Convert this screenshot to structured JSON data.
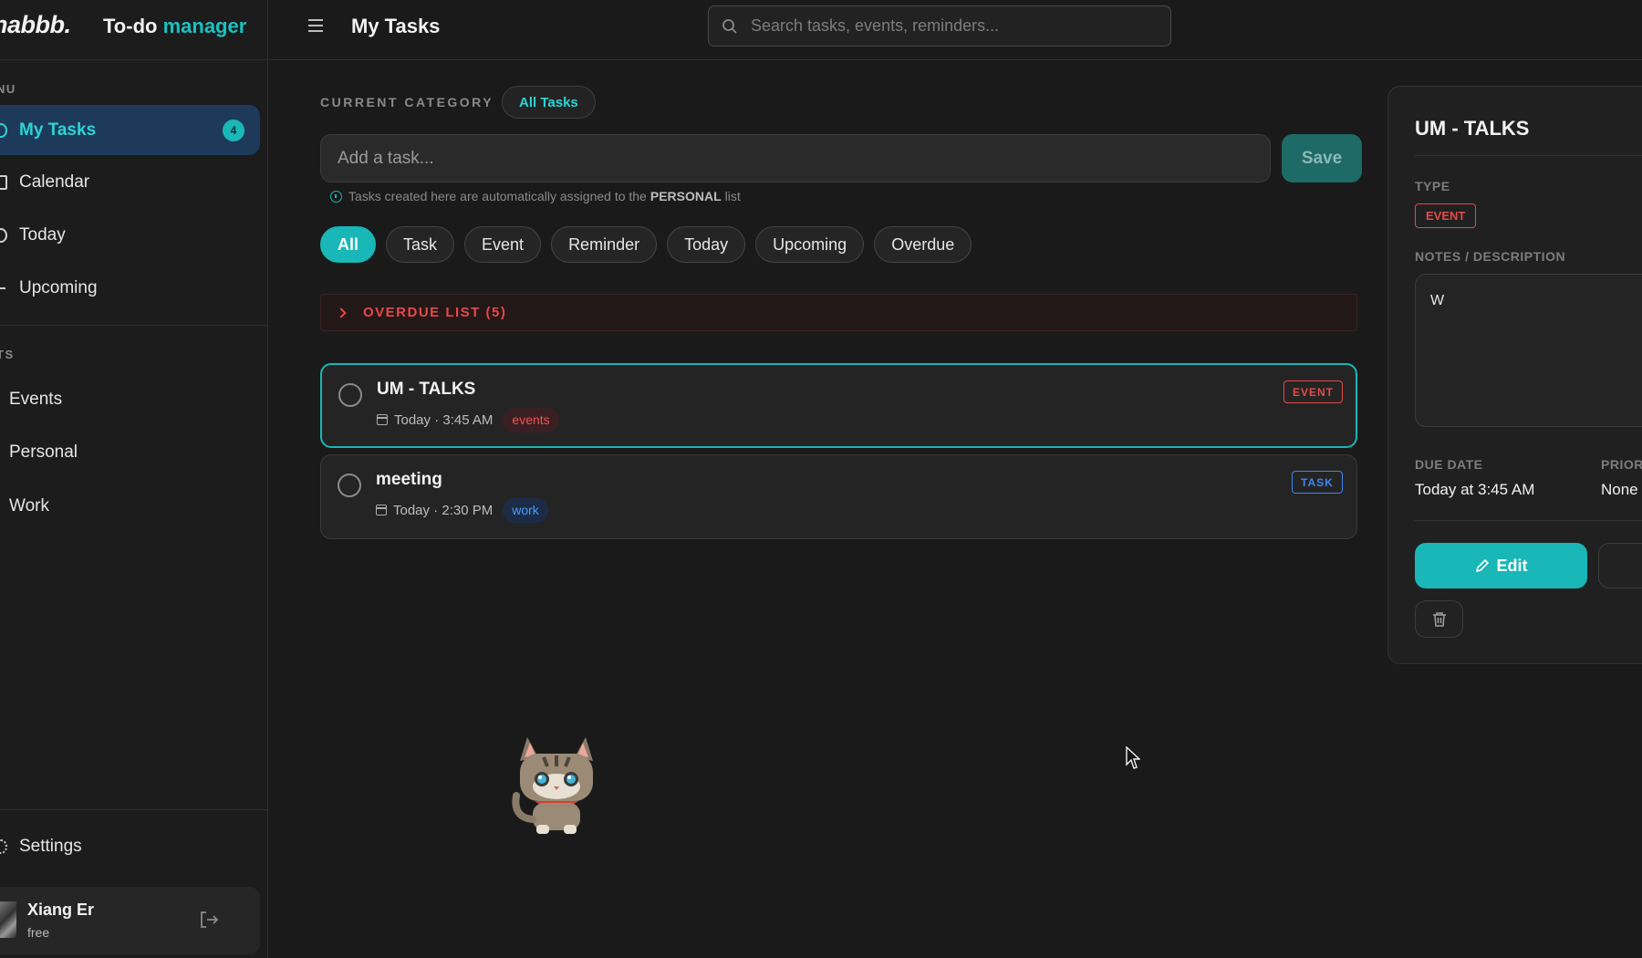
{
  "app": {
    "logo": "nabbb.",
    "name_main": "To-do",
    "name_accent": "manager"
  },
  "sidebar": {
    "menu_label": "NU",
    "menu_items": [
      {
        "label": "My Tasks",
        "badge": "4",
        "active": true
      },
      {
        "label": "Calendar"
      },
      {
        "label": "Today"
      },
      {
        "label": "Upcoming"
      }
    ],
    "lists_label": "TS",
    "lists": [
      {
        "label": "Events"
      },
      {
        "label": "Personal"
      },
      {
        "label": "Work"
      }
    ],
    "settings_label": "Settings",
    "user": {
      "name": "Xiang Er",
      "plan": "free"
    }
  },
  "topbar": {
    "title": "My Tasks",
    "search_placeholder": "Search tasks, events, reminders..."
  },
  "main": {
    "category_label": "CURRENT CATEGORY",
    "category_value": "All Tasks",
    "add_placeholder": "Add a task...",
    "save_label": "Save",
    "hint_prefix": "Tasks created here are automatically assigned to the",
    "hint_list": "PERSONAL",
    "hint_suffix": "list",
    "filters": [
      "All",
      "Task",
      "Event",
      "Reminder",
      "Today",
      "Upcoming",
      "Overdue"
    ],
    "active_filter": "All",
    "overdue_label": "OVERDUE LIST (5)",
    "tasks": [
      {
        "title": "UM - TALKS",
        "meta": "Today · 3:45 AM",
        "tag": "events",
        "type": "EVENT",
        "selected": true
      },
      {
        "title": "meeting",
        "meta": "Today · 2:30 PM",
        "tag": "work",
        "type": "TASK",
        "selected": false
      }
    ]
  },
  "detail": {
    "title": "UM - TALKS",
    "type_label": "TYPE",
    "type_value": "EVENT",
    "notes_label": "NOTES / DESCRIPTION",
    "notes_value": "W",
    "due_label": "DUE DATE",
    "due_value": "Today at 3:45 AM",
    "priority_label": "PRIOR",
    "priority_value": "None",
    "edit_label": "Edit"
  },
  "colors": {
    "accent": "#19b7b7",
    "event": "#e24a4a",
    "task": "#3d86f0",
    "background": "#1a1a1a"
  }
}
